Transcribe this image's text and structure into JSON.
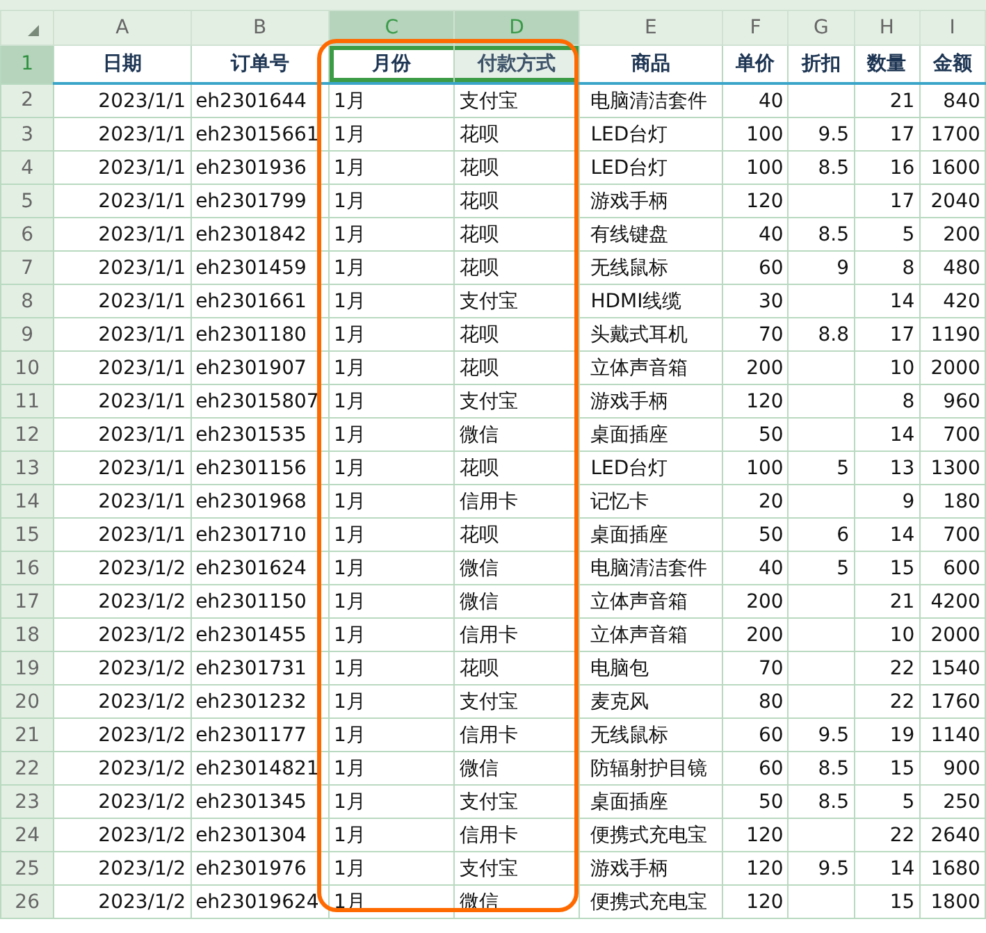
{
  "columns": [
    {
      "letter": "A",
      "selected": false,
      "kind": "number"
    },
    {
      "letter": "B",
      "selected": false,
      "kind": "text"
    },
    {
      "letter": "C",
      "selected": true,
      "kind": "text"
    },
    {
      "letter": "D",
      "selected": true,
      "kind": "text"
    },
    {
      "letter": "E",
      "selected": false,
      "kind": "text"
    },
    {
      "letter": "F",
      "selected": false,
      "kind": "number"
    },
    {
      "letter": "G",
      "selected": false,
      "kind": "number"
    },
    {
      "letter": "H",
      "selected": false,
      "kind": "number"
    },
    {
      "letter": "I",
      "selected": false,
      "kind": "number"
    }
  ],
  "header_row": {
    "number": "1",
    "selected": true,
    "cells": [
      {
        "text": "日期",
        "selected": false
      },
      {
        "text": "订单号",
        "selected": false
      },
      {
        "text": "月份",
        "selected": true
      },
      {
        "text": "付款方式",
        "selected": true
      },
      {
        "text": "商品",
        "selected": false
      },
      {
        "text": "单价",
        "selected": false
      },
      {
        "text": "折扣",
        "selected": false
      },
      {
        "text": "数量",
        "selected": false
      },
      {
        "text": "金额",
        "selected": false
      }
    ]
  },
  "rows": [
    {
      "number": "2",
      "selected": false,
      "cells": [
        "2023/1/1",
        "eh2301644",
        "1月",
        "支付宝",
        "电脑清洁套件",
        "40",
        null,
        "21",
        "840"
      ]
    },
    {
      "number": "3",
      "selected": false,
      "cells": [
        "2023/1/1",
        "eh23015661",
        "1月",
        "花呗",
        "LED台灯",
        "100",
        "9.5",
        "17",
        "1700"
      ]
    },
    {
      "number": "4",
      "selected": false,
      "cells": [
        "2023/1/1",
        "eh2301936",
        "1月",
        "花呗",
        "LED台灯",
        "100",
        "8.5",
        "16",
        "1600"
      ]
    },
    {
      "number": "5",
      "selected": false,
      "cells": [
        "2023/1/1",
        "eh2301799",
        "1月",
        "花呗",
        "游戏手柄",
        "120",
        null,
        "17",
        "2040"
      ]
    },
    {
      "number": "6",
      "selected": false,
      "cells": [
        "2023/1/1",
        "eh2301842",
        "1月",
        "花呗",
        "有线键盘",
        "40",
        "8.5",
        "5",
        "200"
      ]
    },
    {
      "number": "7",
      "selected": false,
      "cells": [
        "2023/1/1",
        "eh2301459",
        "1月",
        "花呗",
        "无线鼠标",
        "60",
        "9",
        "8",
        "480"
      ]
    },
    {
      "number": "8",
      "selected": false,
      "cells": [
        "2023/1/1",
        "eh2301661",
        "1月",
        "支付宝",
        "HDMI线缆",
        "30",
        null,
        "14",
        "420"
      ]
    },
    {
      "number": "9",
      "selected": false,
      "cells": [
        "2023/1/1",
        "eh2301180",
        "1月",
        "花呗",
        "头戴式耳机",
        "70",
        "8.8",
        "17",
        "1190"
      ]
    },
    {
      "number": "10",
      "selected": false,
      "cells": [
        "2023/1/1",
        "eh2301907",
        "1月",
        "花呗",
        "立体声音箱",
        "200",
        null,
        "10",
        "2000"
      ]
    },
    {
      "number": "11",
      "selected": false,
      "cells": [
        "2023/1/1",
        "eh23015807",
        "1月",
        "支付宝",
        "游戏手柄",
        "120",
        null,
        "8",
        "960"
      ]
    },
    {
      "number": "12",
      "selected": false,
      "cells": [
        "2023/1/1",
        "eh2301535",
        "1月",
        "微信",
        "桌面插座",
        "50",
        null,
        "14",
        "700"
      ]
    },
    {
      "number": "13",
      "selected": false,
      "cells": [
        "2023/1/1",
        "eh2301156",
        "1月",
        "花呗",
        "LED台灯",
        "100",
        "5",
        "13",
        "1300"
      ]
    },
    {
      "number": "14",
      "selected": false,
      "cells": [
        "2023/1/1",
        "eh2301968",
        "1月",
        "信用卡",
        "记忆卡",
        "20",
        null,
        "9",
        "180"
      ]
    },
    {
      "number": "15",
      "selected": false,
      "cells": [
        "2023/1/1",
        "eh2301710",
        "1月",
        "花呗",
        "桌面插座",
        "50",
        "6",
        "14",
        "700"
      ]
    },
    {
      "number": "16",
      "selected": false,
      "cells": [
        "2023/1/2",
        "eh2301624",
        "1月",
        "微信",
        "电脑清洁套件",
        "40",
        "5",
        "15",
        "600"
      ]
    },
    {
      "number": "17",
      "selected": false,
      "cells": [
        "2023/1/2",
        "eh2301150",
        "1月",
        "微信",
        "立体声音箱",
        "200",
        null,
        "21",
        "4200"
      ]
    },
    {
      "number": "18",
      "selected": false,
      "cells": [
        "2023/1/2",
        "eh2301455",
        "1月",
        "信用卡",
        "立体声音箱",
        "200",
        null,
        "10",
        "2000"
      ]
    },
    {
      "number": "19",
      "selected": false,
      "cells": [
        "2023/1/2",
        "eh2301731",
        "1月",
        "花呗",
        "电脑包",
        "70",
        null,
        "22",
        "1540"
      ]
    },
    {
      "number": "20",
      "selected": false,
      "cells": [
        "2023/1/2",
        "eh2301232",
        "1月",
        "支付宝",
        "麦克风",
        "80",
        null,
        "22",
        "1760"
      ]
    },
    {
      "number": "21",
      "selected": false,
      "cells": [
        "2023/1/2",
        "eh2301177",
        "1月",
        "信用卡",
        "无线鼠标",
        "60",
        "9.5",
        "19",
        "1140"
      ]
    },
    {
      "number": "22",
      "selected": false,
      "cells": [
        "2023/1/2",
        "eh23014821",
        "1月",
        "微信",
        "防辐射护目镜",
        "60",
        "8.5",
        "15",
        "900"
      ]
    },
    {
      "number": "23",
      "selected": false,
      "cells": [
        "2023/1/2",
        "eh2301345",
        "1月",
        "支付宝",
        "桌面插座",
        "50",
        "8.5",
        "5",
        "250"
      ]
    },
    {
      "number": "24",
      "selected": false,
      "cells": [
        "2023/1/2",
        "eh2301304",
        "1月",
        "信用卡",
        "便携式充电宝",
        "120",
        null,
        "22",
        "2640"
      ]
    },
    {
      "number": "25",
      "selected": false,
      "cells": [
        "2023/1/2",
        "eh2301976",
        "1月",
        "支付宝",
        "游戏手柄",
        "120",
        "9.5",
        "14",
        "1680"
      ]
    },
    {
      "number": "26",
      "selected": false,
      "cells": [
        "2023/1/2",
        "eh23019624",
        "1月",
        "微信",
        "便携式充电宝",
        "120",
        null,
        "15",
        "1800"
      ]
    }
  ]
}
